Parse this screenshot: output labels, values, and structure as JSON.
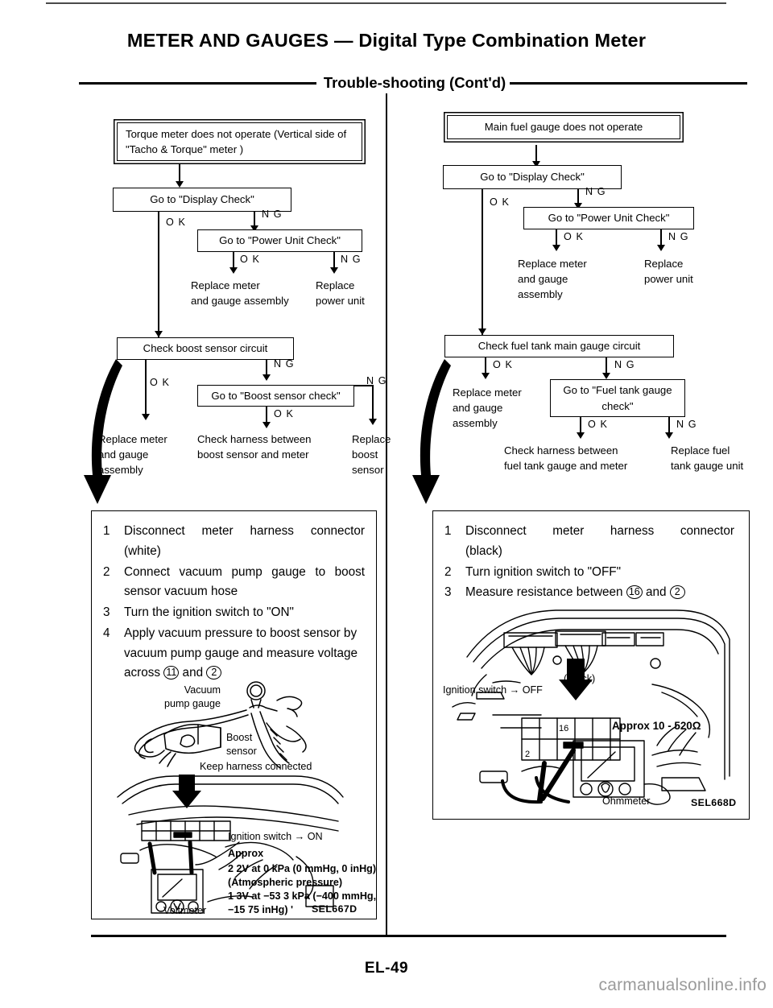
{
  "page": {
    "title_main": "METER AND GAUGES",
    "title_dash": "—",
    "title_sub": "Digital Type Combination Meter",
    "section": "Trouble-shooting (Cont'd)",
    "folio": "EL-49",
    "watermark": "carmanualsonline.info"
  },
  "left_flow": {
    "start": "Torque meter does not operate\n(Vertical side of \"Tacho & Torque\" meter )",
    "display_check": "Go to \"Display Check\"",
    "power_unit_check": "Go to \"Power Unit Check\"",
    "replace_meter_gauge_assembly": "Replace meter\nand gauge assembly",
    "replace_power_unit": "Replace\npower unit",
    "check_boost_sensor_circuit": "Check boost sensor circuit",
    "boost_sensor_check": "Go to \"Boost sensor check\"",
    "replace_meter_and_gauge_assembly": "Replace meter\nand gauge\nassembly",
    "check_harness": "Check harness between\nboost sensor and meter",
    "replace_boost_sensor": "Replace\nboost\nsensor",
    "ok": "O K",
    "ng": "N G"
  },
  "right_flow": {
    "start": "Main fuel gauge does not operate",
    "display_check": "Go to \"Display Check\"",
    "power_unit_check": "Go to \"Power Unit Check\"",
    "replace_meter_and_gauge_assembly": "Replace meter\nand gauge\nassembly",
    "replace_power_unit": "Replace\npower unit",
    "check_fuel_tank_circuit": "Check fuel tank main gauge circuit",
    "replace_meter_gauge_assembly2": "Replace meter\nand gauge\nassembly",
    "fuel_tank_gauge_check": "Go to \"Fuel tank\ngauge check\"",
    "check_harness": "Check harness between\nfuel tank gauge and meter",
    "replace_fuel_tank_gauge_unit": "Replace fuel\ntank gauge unit",
    "ok": "O K",
    "ng": "N G"
  },
  "left_panel": {
    "steps": [
      {
        "num": "1",
        "text": "Disconnect meter harness connector",
        "text2": "(white)",
        "justify": true
      },
      {
        "num": "2",
        "text": "Connect vacuum pump gauge to boost",
        "text2": "sensor vacuum hose",
        "justify": true
      },
      {
        "num": "3",
        "text": "Turn the ignition switch to \"ON\"",
        "text2": "",
        "justify": false
      },
      {
        "num": "4",
        "text": "Apply vacuum pressure to boost sensor by",
        "text2": "vacuum pump gauge and measure voltage",
        "justify": false
      }
    ],
    "step4_tail_pre": "across ",
    "step4_circ1": "11",
    "step4_mid": " and ",
    "step4_circ2": "2",
    "illus1": {
      "vacuum_pump_gauge": "Vacuum\npump gauge",
      "boost_sensor": "Boost\nsensor",
      "keep_harness": "Keep harness connected"
    },
    "illus2": {
      "ignition_switch": "Ignition switch → ON",
      "approx": "Approx",
      "line1": "2 2V at 0 kPa (0 mmHg, 0 inHg)",
      "line2": "(Atmospheric pressure)",
      "line3": "1 3V at −53 3 kPa (−400 mmHg,",
      "line4": "−15 75 inHg) '",
      "voltmeter": "Voltmeter",
      "figcode": "SEL667D"
    }
  },
  "right_panel": {
    "steps": [
      {
        "num": "1",
        "text": "Disconnect meter harness connector",
        "text2": "(black)",
        "justify": true
      },
      {
        "num": "2",
        "text": "Turn ignition switch to \"OFF\"",
        "text2": "",
        "justify": false
      },
      {
        "num": "3",
        "text": "",
        "text2": "",
        "justify": false
      }
    ],
    "step3_pre": "Measure resistance between ",
    "step3_circ1": "16",
    "step3_mid": " and ",
    "step3_circ2": "2",
    "illus": {
      "black": "(Black)",
      "ignition_switch": "Ignition switch → OFF",
      "approx_ohm": "Approx  10 - 520Ω",
      "ohmmeter": "Ohmmeter",
      "pin16": "16",
      "pin2": "2",
      "figcode": "SEL668D"
    }
  }
}
